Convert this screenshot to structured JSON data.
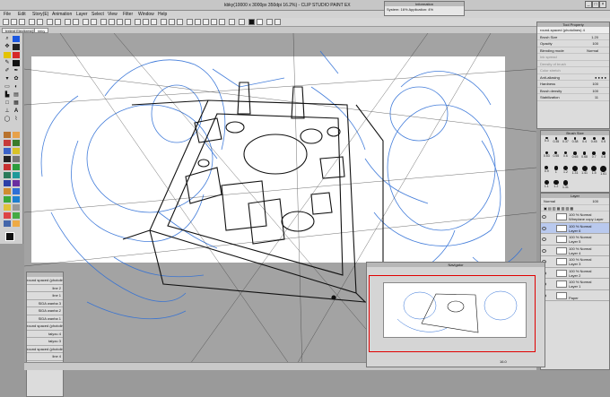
{
  "app": {
    "title": "kbky(10000 x 3000px 350dpi 16.2%) - CLIP STUDIO PAINT EX"
  },
  "menu": [
    "File",
    "Edit",
    "Story(E)",
    "Animation",
    "Layer",
    "Select",
    "View",
    "Filter",
    "Window",
    "Help"
  ],
  "info_window": {
    "title": "Information",
    "text": "System: 16% Application: 4%"
  },
  "tabs": [
    "trelent Eleclkrest(1)",
    "kbky"
  ],
  "tool_property": {
    "title": "Tool Property",
    "brush_name": "round-spaced (photolines) 4",
    "rows": [
      {
        "label": "Brush Size",
        "value": "1.20"
      },
      {
        "label": "Opacity",
        "value": "100"
      },
      {
        "label": "Blending mode",
        "value": "Normal"
      },
      {
        "label": "Ink spread",
        "value": ""
      },
      {
        "label": "Density of brush",
        "value": ""
      },
      {
        "label": "Color stretch",
        "value": ""
      },
      {
        "label": "Anti-aliasing",
        "value": ""
      },
      {
        "label": "Hardness",
        "value": "100"
      },
      {
        "label": "Brush density",
        "value": "100"
      },
      {
        "label": "Stabilization",
        "value": "11"
      }
    ]
  },
  "brush_size": {
    "title": "Brush Size",
    "sizes": [
      "0.3",
      "0.35",
      "0.37",
      "0.38",
      "0.4",
      "0.45",
      "0.5",
      "0.53",
      "0.55",
      "0.6",
      "0.65",
      "0.68",
      "0.7",
      "0.8",
      "0.9",
      "1",
      "1.2",
      "1.31",
      "1.41",
      "1.5",
      "1.61",
      "1.1",
      "1.2",
      "1.31"
    ]
  },
  "layer_panel": {
    "title": "Layer",
    "blend_mode": "Normal",
    "opacity": "100",
    "layers": [
      {
        "line1": "100 % Normal",
        "line2": "Wireplane copy Layer"
      },
      {
        "line1": "100 % Normal",
        "line2": "Layer 6"
      },
      {
        "line1": "100 % Normal",
        "line2": "Layer 5"
      },
      {
        "line1": "100 % Normal",
        "line2": "Layer 4"
      },
      {
        "line1": "100 % Normal",
        "line2": "Layer 3"
      },
      {
        "line1": "100 % Normal",
        "line2": "Layer 2"
      },
      {
        "line1": "100 % Normal",
        "line2": "Layer 1"
      },
      {
        "line1": "",
        "line2": "Paper"
      }
    ]
  },
  "navigator": {
    "title": "Navigator",
    "zoom": "16.0"
  },
  "subtool": {
    "items": [
      "round spaced (photolin",
      "line 2",
      "line 1",
      "SIDA wanha 3",
      "SIDA wanha 2",
      "SIDA wanha 1",
      "round spaced (photolin",
      "taiyou 4",
      "taiyou 3",
      "round spaced (photolin",
      "line 4"
    ]
  },
  "colors": {
    "sketch_blue": "#2f6fd6",
    "sketch_black": "#111111",
    "panel_bg": "#dcdcdc",
    "selected_layer": "#b9c9ee",
    "nav_frame": "#e00000"
  }
}
